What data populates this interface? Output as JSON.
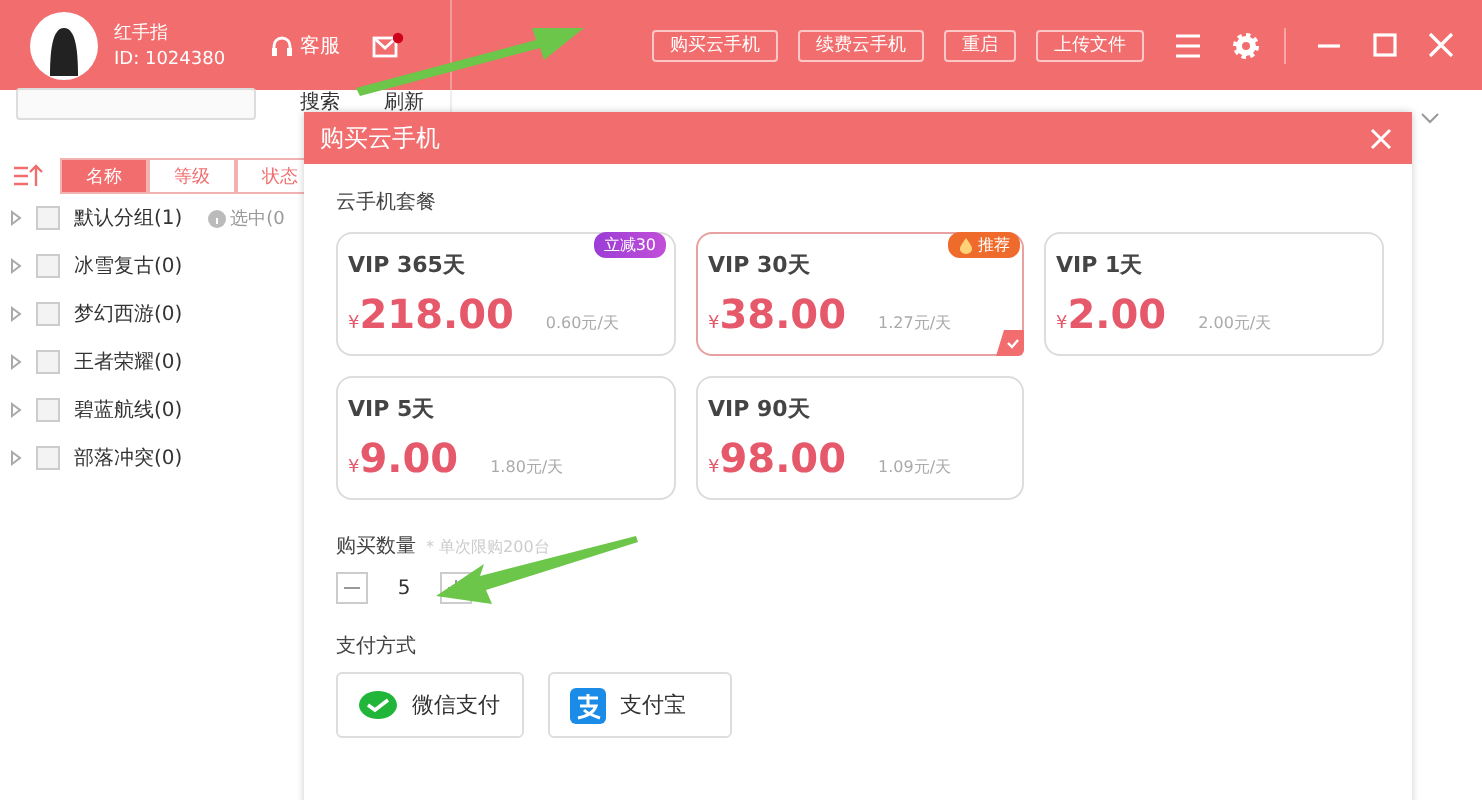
{
  "header": {
    "user_name": "红手指",
    "user_id": "ID: 1024380",
    "service": "客服",
    "mail_unread": true,
    "buttons": [
      "购买云手机",
      "续费云手机",
      "重启",
      "上传文件"
    ]
  },
  "sidebar": {
    "search_buttons": [
      "搜索",
      "刷新"
    ],
    "sort_tabs": [
      {
        "label": "名称",
        "selected": true
      },
      {
        "label": "等级",
        "selected": false
      },
      {
        "label": "状态",
        "selected": false
      }
    ],
    "selected_info": "选中(0",
    "groups": [
      {
        "name": "默认分组(1)",
        "checked": false
      },
      {
        "name": "冰雪复古(0)",
        "checked": false
      },
      {
        "name": "梦幻西游(0)",
        "checked": false
      },
      {
        "name": "王者荣耀(0)",
        "checked": false
      },
      {
        "name": "碧蓝航线(0)",
        "checked": false
      },
      {
        "name": "部落冲突(0)",
        "checked": false
      }
    ]
  },
  "dialog": {
    "title": "购买云手机",
    "packages_label": "云手机套餐",
    "packages": [
      {
        "name": "VIP 365天",
        "currency": "¥",
        "price": "218.00",
        "per_day": "0.60元/天",
        "selected": false,
        "badge": {
          "kind": "discount",
          "text": "立减30"
        }
      },
      {
        "name": "VIP 30天",
        "currency": "¥",
        "price": "38.00",
        "per_day": "1.27元/天",
        "selected": true,
        "badge": {
          "kind": "recommend",
          "text": "推荐"
        }
      },
      {
        "name": "VIP 1天",
        "currency": "¥",
        "price": "2.00",
        "per_day": "2.00元/天",
        "selected": false
      },
      {
        "name": "VIP 5天",
        "currency": "¥",
        "price": "9.00",
        "per_day": "1.80元/天",
        "selected": false
      },
      {
        "name": "VIP 90天",
        "currency": "¥",
        "price": "98.00",
        "per_day": "1.09元/天",
        "selected": false
      }
    ],
    "quantity_label": "购买数量",
    "quantity_note": "* 单次限购200台",
    "quantity": "5",
    "payment_label": "支付方式",
    "payments": [
      {
        "kind": "wechat",
        "label": "微信支付"
      },
      {
        "kind": "alipay",
        "label": "支付宝"
      }
    ]
  }
}
